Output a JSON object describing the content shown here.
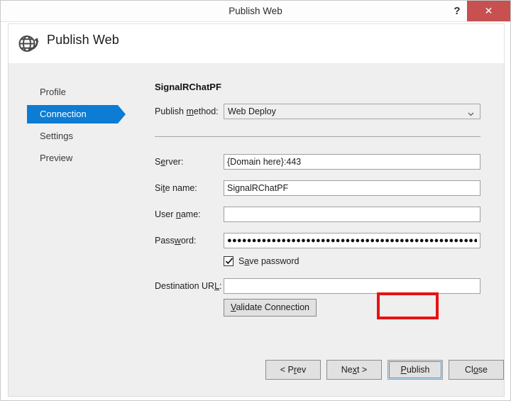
{
  "window": {
    "title": "Publish Web",
    "help_label": "?",
    "close_label": "✕",
    "close_color": "#c75050"
  },
  "header": {
    "title": "Publish Web",
    "icon": "globe-publish-icon"
  },
  "nav": {
    "items": [
      {
        "label": "Profile",
        "selected": false
      },
      {
        "label": "Connection",
        "selected": true
      },
      {
        "label": "Settings",
        "selected": false
      },
      {
        "label": "Preview",
        "selected": false
      }
    ],
    "selected_color": "#0c7cd5"
  },
  "content": {
    "project_title": "SignalRChatPF",
    "publish_method": {
      "label_prefix": "Publish ",
      "label_accel": "m",
      "label_suffix": "ethod:",
      "selected_value": "Web Deploy",
      "options": [
        "Web Deploy"
      ]
    },
    "fields": [
      {
        "name": "server",
        "label_prefix": "S",
        "label_accel": "e",
        "label_suffix": "rver:",
        "value": "{Domain here}:443",
        "placeholder": ""
      },
      {
        "name": "site-name",
        "label_prefix": "Si",
        "label_accel": "t",
        "label_suffix": "e name:",
        "value": "SignalRChatPF",
        "placeholder": ""
      },
      {
        "name": "user-name",
        "label_prefix": "User ",
        "label_accel": "n",
        "label_suffix": "ame:",
        "value": "",
        "placeholder": ""
      },
      {
        "name": "password",
        "label_prefix": "Pass",
        "label_accel": "w",
        "label_suffix": "ord:",
        "value": "●●●●●●●●●●●●●●●●●●●●●●●●●●●●●●●●●●●●●●●●●●●●●●●●●●●●●●●●",
        "placeholder": ""
      },
      {
        "name": "destination-url",
        "label_prefix": "Destination UR",
        "label_accel": "L",
        "label_suffix": ":",
        "value": "",
        "placeholder": ""
      }
    ],
    "save_password": {
      "label_prefix": "S",
      "label_accel": "a",
      "label_suffix": "ve password",
      "checked": true
    },
    "validate_button": {
      "label_prefix": "",
      "label_accel": "V",
      "label_suffix": "alidate Connection"
    }
  },
  "footer": {
    "buttons": [
      {
        "name": "prev",
        "prefix": "< P",
        "accel": "r",
        "suffix": "ev",
        "highlighted": false
      },
      {
        "name": "next",
        "prefix": "Ne",
        "accel": "x",
        "suffix": "t >",
        "highlighted": false
      },
      {
        "name": "publish",
        "prefix": "",
        "accel": "P",
        "suffix": "ublish",
        "highlighted": true
      },
      {
        "name": "close",
        "prefix": "Cl",
        "accel": "o",
        "suffix": "se",
        "highlighted": false
      }
    ],
    "highlight_color": "#e81212",
    "focus_color": "#3b9bdd"
  }
}
